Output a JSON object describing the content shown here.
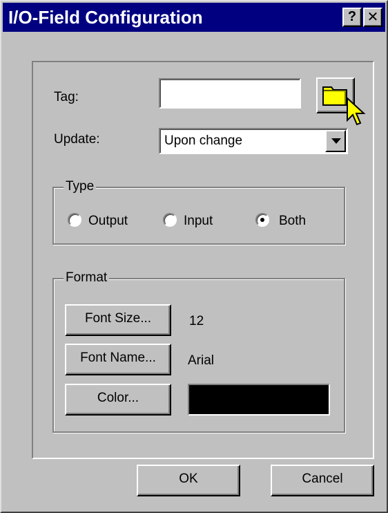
{
  "window": {
    "title": "I/O-Field Configuration",
    "help_label": "?",
    "close_label": "✕"
  },
  "tag": {
    "label": "Tag:",
    "value": "",
    "browse_icon": "folder-icon"
  },
  "update": {
    "label": "Update:",
    "selected": "Upon change"
  },
  "type_group": {
    "title": "Type",
    "options": [
      {
        "label": "Output",
        "checked": false
      },
      {
        "label": "Input",
        "checked": false
      },
      {
        "label": "Both",
        "checked": true
      }
    ]
  },
  "format_group": {
    "title": "Format",
    "font_size_button": "Font Size...",
    "font_size_value": "12",
    "font_name_button": "Font Name...",
    "font_name_value": "Arial",
    "color_button": "Color...",
    "color_value": "#000000"
  },
  "buttons": {
    "ok": "OK",
    "cancel": "Cancel"
  },
  "colors": {
    "titlebar": "#000080",
    "face": "#c0c0c0",
    "folder": "#ffff00"
  }
}
